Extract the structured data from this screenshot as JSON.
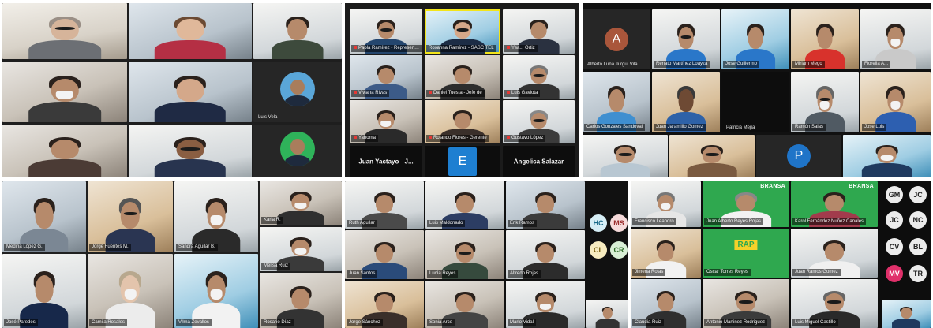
{
  "panels": {
    "p1": {
      "tiles": [
        {
          "name": "",
          "bg": "bg-b"
        },
        {
          "name": "",
          "bg": "bg-c"
        },
        {
          "name": "",
          "bg": "bg-e"
        },
        {
          "name": "",
          "bg": "bg-a"
        },
        {
          "name": "",
          "bg": "bg-c"
        },
        {
          "name": "Luis Vela",
          "bg": "dark-avatar"
        },
        {
          "name": "",
          "bg": "bg-a"
        },
        {
          "name": "",
          "bg": "bg-e"
        },
        {
          "name": "",
          "bg": "dark-avatar"
        }
      ]
    },
    "p2": {
      "tiles": [
        {
          "name": "Paola Ramírez - Representant",
          "bg": "bg-e"
        },
        {
          "name": "Roxanna Ramírez - SASC TEL",
          "bg": "bg-teal",
          "speaker": true
        },
        {
          "name": "Ysa... Ortiz",
          "bg": "bg-e"
        },
        {
          "name": "Viviana Rivas",
          "bg": "bg-c"
        },
        {
          "name": "Daniel Tuesta - Jefe de",
          "bg": "bg-a"
        },
        {
          "name": "Luis Gaviota",
          "bg": "bg-e"
        },
        {
          "name": "Yahoma",
          "bg": "bg-a"
        },
        {
          "name": "Rolando Flores - Gerente",
          "bg": "bg-d"
        },
        {
          "name": "Gustavo López",
          "bg": "bg-e"
        }
      ],
      "bottom": [
        {
          "label": "Juan Yactayo - J..."
        },
        {
          "label": "E"
        },
        {
          "label": "Angelica Salazar"
        }
      ]
    },
    "p3": {
      "initials_a": "A",
      "initials_p": "P",
      "tiles": [
        {
          "name": "Alberto Luna Jurgul Vila"
        },
        {
          "name": "Renato Martínez Loayza"
        },
        {
          "name": "Jose Guillermo"
        },
        {
          "name": "Miriam Mego"
        },
        {
          "name": "Fiorella A..."
        },
        {
          "name": "Carlos Gonzales Sandoval"
        },
        {
          "name": "Juan Jaramillo Gomez"
        },
        {
          "name": "Patricia Mejía"
        },
        {
          "name": "Ramón Salas"
        },
        {
          "name": "Jose Luis"
        },
        {
          "name": ""
        },
        {
          "name": ""
        },
        {
          "name": ""
        },
        {
          "name": ""
        }
      ]
    },
    "p4": {
      "tiles": [
        {
          "name": "Medina López G."
        },
        {
          "name": "Jorge Fuentes M."
        },
        {
          "name": "Sandra Aguilar B."
        },
        {
          "name": "Karla R."
        },
        {
          "name": "Melisa Ruiz"
        },
        {
          "name": "José Paredes"
        },
        {
          "name": "Camila Rosales"
        },
        {
          "name": "Vilma Zevallos"
        },
        {
          "name": "Rosario Díaz"
        }
      ]
    },
    "p5": {
      "chips": [
        {
          "initials": "HC",
          "color": "#d6eef6",
          "text": "#1a6b8a"
        },
        {
          "initials": "MS",
          "color": "#f6dada",
          "text": "#9a2b2b"
        },
        {
          "initials": "CL",
          "color": "#f8ecc0",
          "text": "#7a6010"
        },
        {
          "initials": "CR",
          "color": "#d9efd6",
          "text": "#2d6b27"
        }
      ],
      "tiles": [
        {
          "name": "Ruth Aguilar"
        },
        {
          "name": "Luis Maldonado"
        },
        {
          "name": "Erik Ramos"
        },
        {
          "name": "Juan Santos"
        },
        {
          "name": "Lucía Reyes"
        },
        {
          "name": "Alfredo Rojas"
        },
        {
          "name": "Jorge Sánchez"
        },
        {
          "name": "Sonia Arce"
        },
        {
          "name": "Mario Vidal"
        }
      ]
    },
    "p6": {
      "brand": "BRANSA",
      "rap": "RAP",
      "chips": [
        {
          "initials": "GM",
          "color": "#ececec",
          "text": "#222"
        },
        {
          "initials": "JC",
          "color": "#ececec",
          "text": "#222"
        },
        {
          "initials": "JC",
          "color": "#ececec",
          "text": "#222"
        },
        {
          "initials": "NC",
          "color": "#ececec",
          "text": "#222"
        },
        {
          "initials": "CV",
          "color": "#ececec",
          "text": "#222"
        },
        {
          "initials": "BL",
          "color": "#ececec",
          "text": "#222"
        },
        {
          "initials": "MV",
          "color": "#e0306a",
          "text": "#ffffff"
        },
        {
          "initials": "TR",
          "color": "#ececec",
          "text": "#222"
        }
      ],
      "tiles": [
        {
          "name": "Francisco Leandro"
        },
        {
          "name": "Juan Alberto Reyes Rojas"
        },
        {
          "name": "Karol Fernández Nuñez Canales"
        },
        {
          "name": "Jimena Rojas"
        },
        {
          "name": "Oscar Torres Reyes"
        },
        {
          "name": "Juan Ramos Gomez"
        },
        {
          "name": "Claudia Ruiz"
        },
        {
          "name": "Antonio Martinez Rodriguez"
        },
        {
          "name": "Luis Miguel Castillo"
        }
      ]
    }
  }
}
